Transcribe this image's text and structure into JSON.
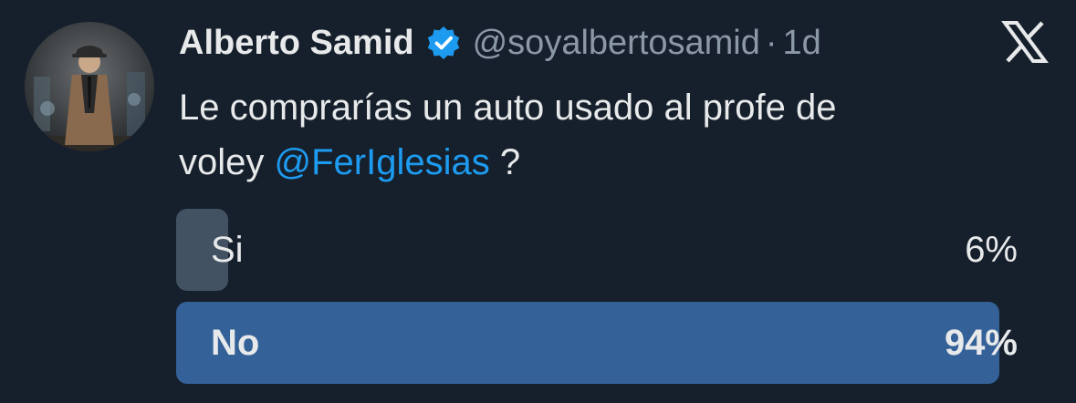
{
  "tweet": {
    "author_name": "Alberto Samid",
    "handle": "@soyalbertosamid",
    "separator": "·",
    "time": "1d",
    "text_line1": "Le comprarías un auto usado al profe de",
    "text_line2_prefix": "voley ",
    "mention": "@FerIglesias",
    "text_line2_suffix": " ?"
  },
  "poll": {
    "options": [
      {
        "label": "Si",
        "percent_text": "6%",
        "percent": 6,
        "winner": false
      },
      {
        "label": "No",
        "percent_text": "94%",
        "percent": 94,
        "winner": true
      }
    ]
  },
  "colors": {
    "background": "#16202c",
    "text": "#e7e9ea",
    "secondary_text": "#8b98a5",
    "mention": "#1d9bf0",
    "verified_badge": "#1d9bf0",
    "poll_bar_loser": "#435262",
    "poll_bar_winner": "#336198"
  },
  "icons": {
    "verified": "verified-badge-icon",
    "platform": "x-logo-icon"
  }
}
